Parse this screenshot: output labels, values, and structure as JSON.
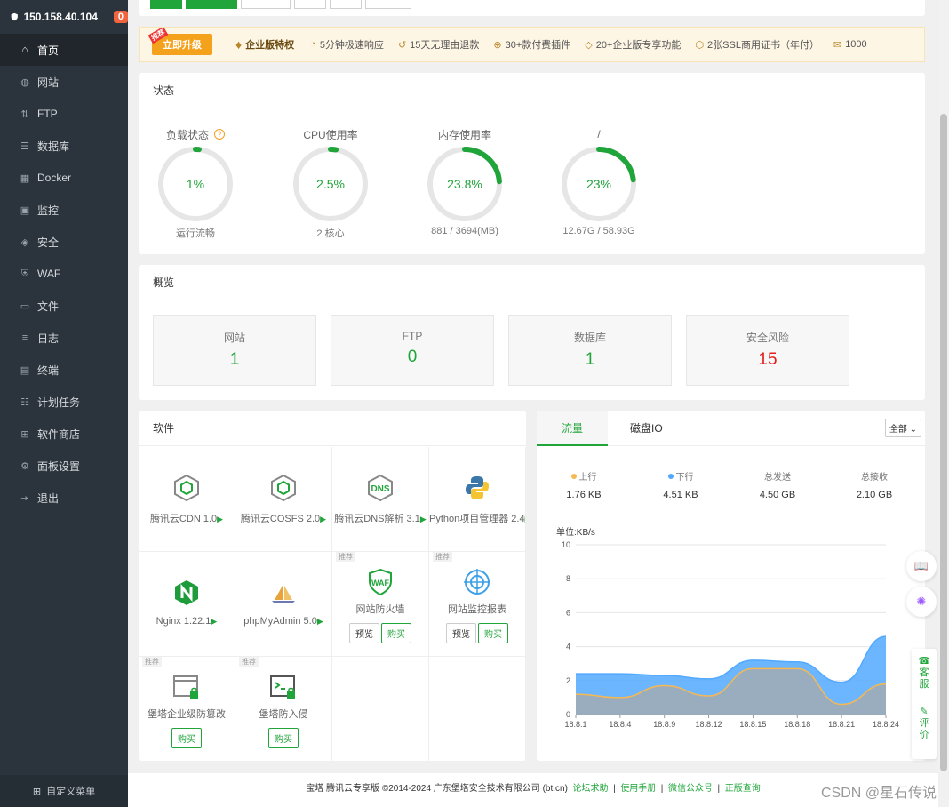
{
  "sidebar": {
    "server_ip": "150.158.40.104",
    "badge": "0",
    "items": [
      {
        "label": "首页",
        "icon": "home-icon",
        "glyph": "⌂",
        "active": true
      },
      {
        "label": "网站",
        "icon": "globe-icon",
        "glyph": "◍"
      },
      {
        "label": "FTP",
        "icon": "ftp-icon",
        "glyph": "⇅"
      },
      {
        "label": "数据库",
        "icon": "database-icon",
        "glyph": "☰"
      },
      {
        "label": "Docker",
        "icon": "docker-icon",
        "glyph": "▦"
      },
      {
        "label": "监控",
        "icon": "monitor-icon",
        "glyph": "▣"
      },
      {
        "label": "安全",
        "icon": "shield-icon",
        "glyph": "◈"
      },
      {
        "label": "WAF",
        "icon": "waf-icon",
        "glyph": "⛨"
      },
      {
        "label": "文件",
        "icon": "folder-icon",
        "glyph": "▭"
      },
      {
        "label": "日志",
        "icon": "log-icon",
        "glyph": "≡"
      },
      {
        "label": "终端",
        "icon": "terminal-icon",
        "glyph": "▤"
      },
      {
        "label": "计划任务",
        "icon": "schedule-icon",
        "glyph": "☷"
      },
      {
        "label": "软件商店",
        "icon": "store-icon",
        "glyph": "⊞"
      },
      {
        "label": "面板设置",
        "icon": "settings-icon",
        "glyph": "⚙"
      },
      {
        "label": "退出",
        "icon": "logout-icon",
        "glyph": "⇥"
      }
    ],
    "footer": "自定义菜单"
  },
  "promo": {
    "tag": "推荐",
    "upgrade": "立即升级",
    "enterprise": "企业版特权",
    "features": [
      {
        "icon": "clock-icon",
        "text": "5分钟极速响应"
      },
      {
        "icon": "refund-icon",
        "text": "15天无理由退款"
      },
      {
        "icon": "plugin-icon",
        "text": "30+款付费插件"
      },
      {
        "icon": "enterprise-icon",
        "text": "20+企业版专享功能"
      },
      {
        "icon": "ssl-icon",
        "text": "2张SSL商用证书（年付）"
      },
      {
        "icon": "mail-icon",
        "text": "1000"
      }
    ]
  },
  "status": {
    "title": "状态",
    "gauges": [
      {
        "label": "负载状态",
        "value_text": "1%",
        "percent": 1,
        "sub": "运行流畅",
        "help": "?"
      },
      {
        "label": "CPU使用率",
        "value_text": "2.5%",
        "percent": 2.5,
        "sub": "2 核心"
      },
      {
        "label": "内存使用率",
        "value_text": "23.8%",
        "percent": 23.8,
        "sub": "881 / 3694(MB)"
      },
      {
        "label": "/",
        "value_text": "23%",
        "percent": 23,
        "sub": "12.67G / 58.93G"
      }
    ]
  },
  "overview": {
    "title": "概览",
    "items": [
      {
        "label": "网站",
        "value": "1",
        "color": "#20a53a"
      },
      {
        "label": "FTP",
        "value": "0",
        "color": "#20a53a"
      },
      {
        "label": "数据库",
        "value": "1",
        "color": "#20a53a"
      },
      {
        "label": "安全风险",
        "value": "15",
        "color": "#e31c1c"
      }
    ]
  },
  "software": {
    "title": "软件",
    "recommend": "推荐",
    "preview": "预览",
    "buy": "购买",
    "items": [
      {
        "name": "腾讯云CDN 1.0",
        "icon": "tencent-cdn-icon",
        "arrow": "▶"
      },
      {
        "name": "腾讯云COSFS 2.0",
        "icon": "tencent-cosfs-icon",
        "arrow": "▶"
      },
      {
        "name": "腾讯云DNS解析 3.1",
        "icon": "dns-icon",
        "arrow": "▶"
      },
      {
        "name": "Python项目管理器 2.4",
        "icon": "python-icon",
        "arrow": "▶"
      },
      {
        "name": "Nginx 1.22.1",
        "icon": "nginx-icon",
        "arrow": "▶"
      },
      {
        "name": "phpMyAdmin 5.0",
        "icon": "phpmyadmin-icon",
        "arrow": "▶"
      },
      {
        "name": "网站防火墙",
        "icon": "waf-shield-icon",
        "rec": true,
        "buttons": [
          "预览",
          "购买"
        ]
      },
      {
        "name": "网站监控报表",
        "icon": "target-icon",
        "rec": true,
        "buttons": [
          "预览",
          "购买"
        ]
      },
      {
        "name": "堡塔企业级防篡改",
        "icon": "tamper-lock-icon",
        "rec": true,
        "buttons": [
          "购买"
        ]
      },
      {
        "name": "堡塔防入侵",
        "icon": "intrusion-lock-icon",
        "rec": true,
        "buttons": [
          "购买"
        ]
      }
    ]
  },
  "traffic": {
    "tabs": [
      "流量",
      "磁盘IO"
    ],
    "select": "全部",
    "stats": [
      {
        "label": "上行",
        "value": "1.76 KB",
        "dot": "#f7b851"
      },
      {
        "label": "下行",
        "value": "4.51 KB",
        "dot": "#52a9ff"
      },
      {
        "label": "总发送",
        "value": "4.50 GB"
      },
      {
        "label": "总接收",
        "value": "2.10 GB"
      }
    ],
    "unit": "单位:KB/s"
  },
  "chart_data": {
    "type": "area",
    "x": [
      "18:8:1",
      "18:8:4",
      "18:8:9",
      "18:8:12",
      "18:8:15",
      "18:8:18",
      "18:8:21",
      "18:8:24"
    ],
    "y_ticks": [
      0,
      2,
      4,
      6,
      8,
      10
    ],
    "ylim": [
      0,
      10
    ],
    "series": [
      {
        "name": "上行",
        "color": "#f7b851",
        "values": [
          1.2,
          1.0,
          1.7,
          1.1,
          2.7,
          2.7,
          0.6,
          1.8
        ]
      },
      {
        "name": "下行",
        "color": "#52a9ff",
        "values": [
          2.4,
          2.4,
          2.3,
          2.1,
          3.2,
          3.1,
          1.9,
          4.6
        ]
      }
    ],
    "grid": true
  },
  "footer": {
    "copyright": "宝塔 腾讯云专享版 ©2014-2024 广东堡塔安全技术有限公司 (bt.cn)",
    "links": [
      "论坛求助",
      "使用手册",
      "微信公众号",
      "正版查询"
    ],
    "sep": "|",
    "watermark": "CSDN @星石传说"
  },
  "floating": {
    "kefu": "客服",
    "pingjia": "评价"
  }
}
